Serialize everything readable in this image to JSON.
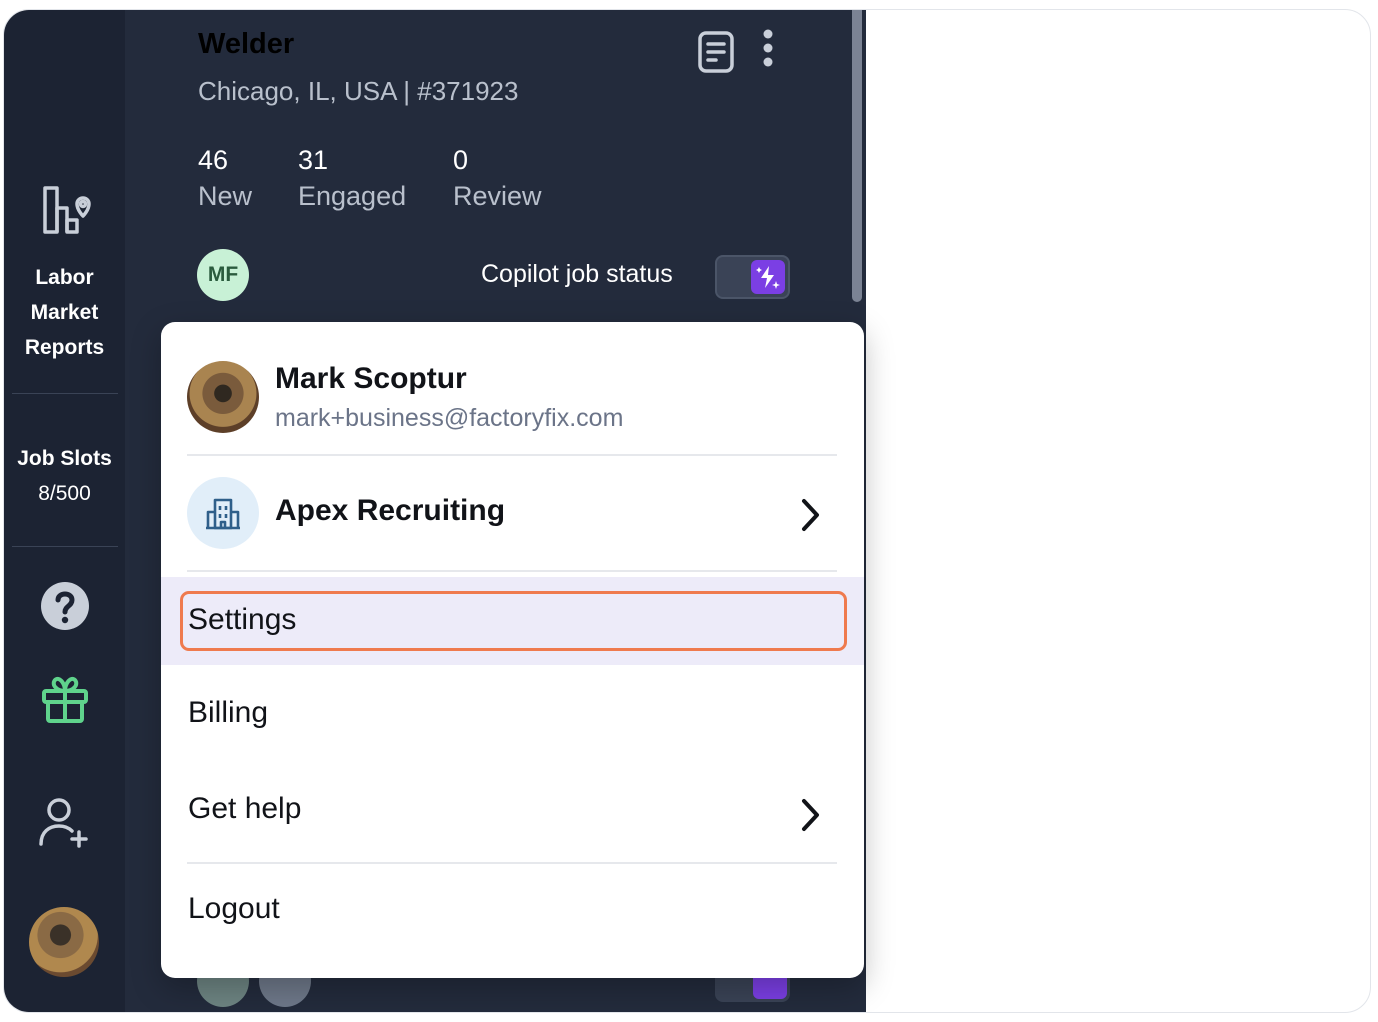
{
  "sidebar": {
    "labor_market_reports": "Labor\nMarket\nReports",
    "labor_line1": "Labor",
    "labor_line2": "Market",
    "labor_line3": "Reports",
    "job_slots_title": "Job Slots",
    "job_slots_value": "8/500",
    "icons": [
      "labor-market-icon",
      "help-icon",
      "gift-icon",
      "add-user-icon"
    ]
  },
  "job": {
    "title": "Welder",
    "location": "Chicago, IL, USA",
    "separator": "|",
    "id": "#371923",
    "stats": [
      {
        "value": "46",
        "label": "New"
      },
      {
        "value": "31",
        "label": "Engaged"
      },
      {
        "value": "0",
        "label": "Review"
      }
    ],
    "assignee_initials": "MF",
    "copilot_label": "Copilot job status",
    "copilot_enabled": true
  },
  "menu": {
    "user_name": "Mark Scoptur",
    "user_email": "mark+business@factoryfix.com",
    "org_name": "Apex Recruiting",
    "items": [
      "Settings",
      "Billing",
      "Get help",
      "Logout"
    ],
    "highlighted": "Settings"
  },
  "colors": {
    "rail_bg": "#1c2333",
    "panel_bg": "#232b3c",
    "accent_purple": "#7b3fe4",
    "highlight_border": "#ef7a4e",
    "highlight_bg": "#edebf9",
    "gift_green": "#5fd38c"
  }
}
